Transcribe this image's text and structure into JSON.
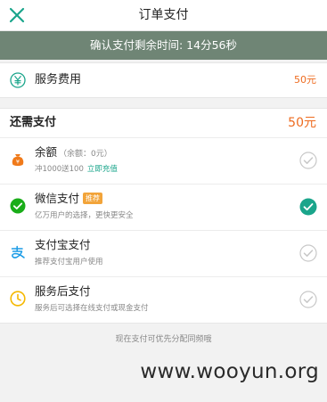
{
  "header": {
    "title": "订单支付",
    "close_icon": "close-icon"
  },
  "countdown": {
    "text": "确认支付剩余时间: 14分56秒"
  },
  "fee": {
    "icon": "yuan-icon",
    "label": "服务费用",
    "amount": "50元"
  },
  "payment": {
    "need_label": "还需支付",
    "need_amount": "50元",
    "methods": [
      {
        "name": "balance",
        "icon": "wallet-icon",
        "title": "余额",
        "note": "（余额：0元）",
        "sub": "冲1000送100",
        "link": "立即充值",
        "selected": false
      },
      {
        "name": "wechat",
        "icon": "wechat-pay-icon",
        "title": "微信支付",
        "badge": "推荐",
        "sub": "亿万用户的选择，更快更安全",
        "selected": true
      },
      {
        "name": "alipay",
        "icon": "alipay-icon",
        "title": "支付宝支付",
        "sub": "推荐支付宝用户使用",
        "selected": false
      },
      {
        "name": "pay-later",
        "icon": "clock-icon",
        "title": "服务后支付",
        "sub": "服务后可选择在线支付或现金支付",
        "selected": false
      }
    ]
  },
  "footer": {
    "hint": "现在支付可优先分配同频哦"
  },
  "watermark": "www.wooyun.org",
  "colors": {
    "accent_teal": "#1aa58b",
    "countdown_bg": "#6f8575",
    "amount_orange": "#ee6b1f",
    "badge_orange": "#f2a43a",
    "wechat_green": "#1aad19",
    "alipay_blue": "#1a9be6",
    "clock_yellow": "#f5b800"
  }
}
